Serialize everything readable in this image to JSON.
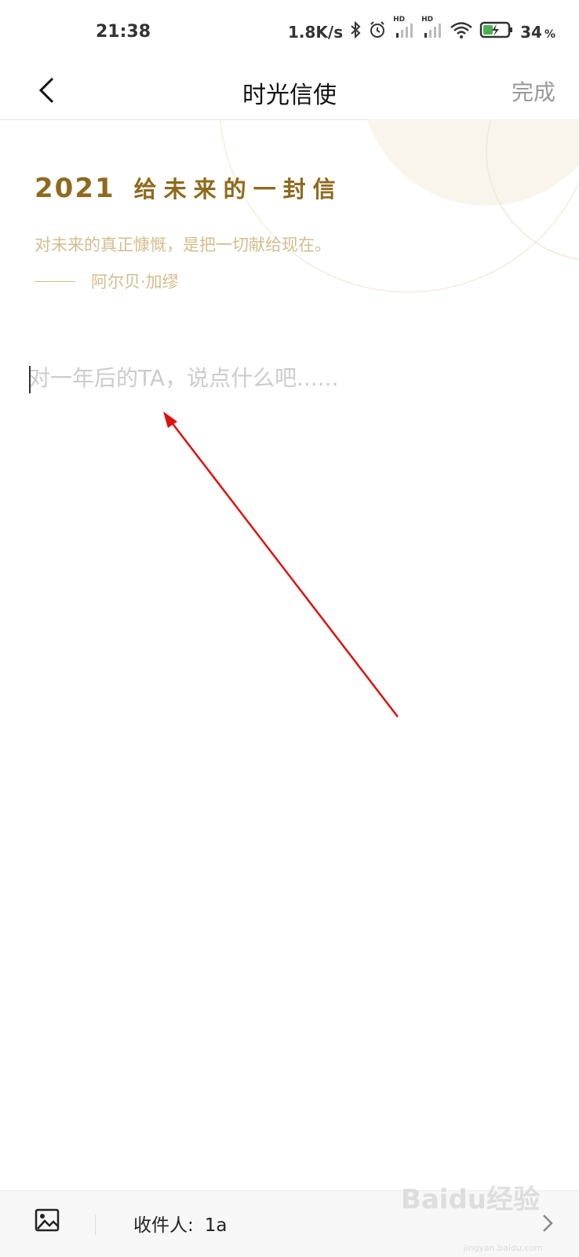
{
  "status": {
    "time": "21:38",
    "net_speed": "1.8K/s",
    "hd_1": "HD",
    "hd_2": "HD",
    "battery": "34",
    "battery_unit": "%"
  },
  "nav": {
    "title": "时光信使",
    "done_label": "完成"
  },
  "letter": {
    "year": "2021",
    "heading": "给未来的一封信",
    "quote": "对未来的真正慷慨，是把一切献给现在。",
    "author": "阿尔贝·加缪",
    "placeholder": "对一年后的TA，说点什么吧......"
  },
  "footer": {
    "recipient_label": "收件人:",
    "recipient_value": "1a"
  },
  "watermark": {
    "text": "Baidu经验",
    "sub": "jingyan.baidu.com"
  },
  "colors": {
    "gold": "#8f6a1d",
    "quote": "#d3bd8f",
    "arrow": "#e01010"
  }
}
